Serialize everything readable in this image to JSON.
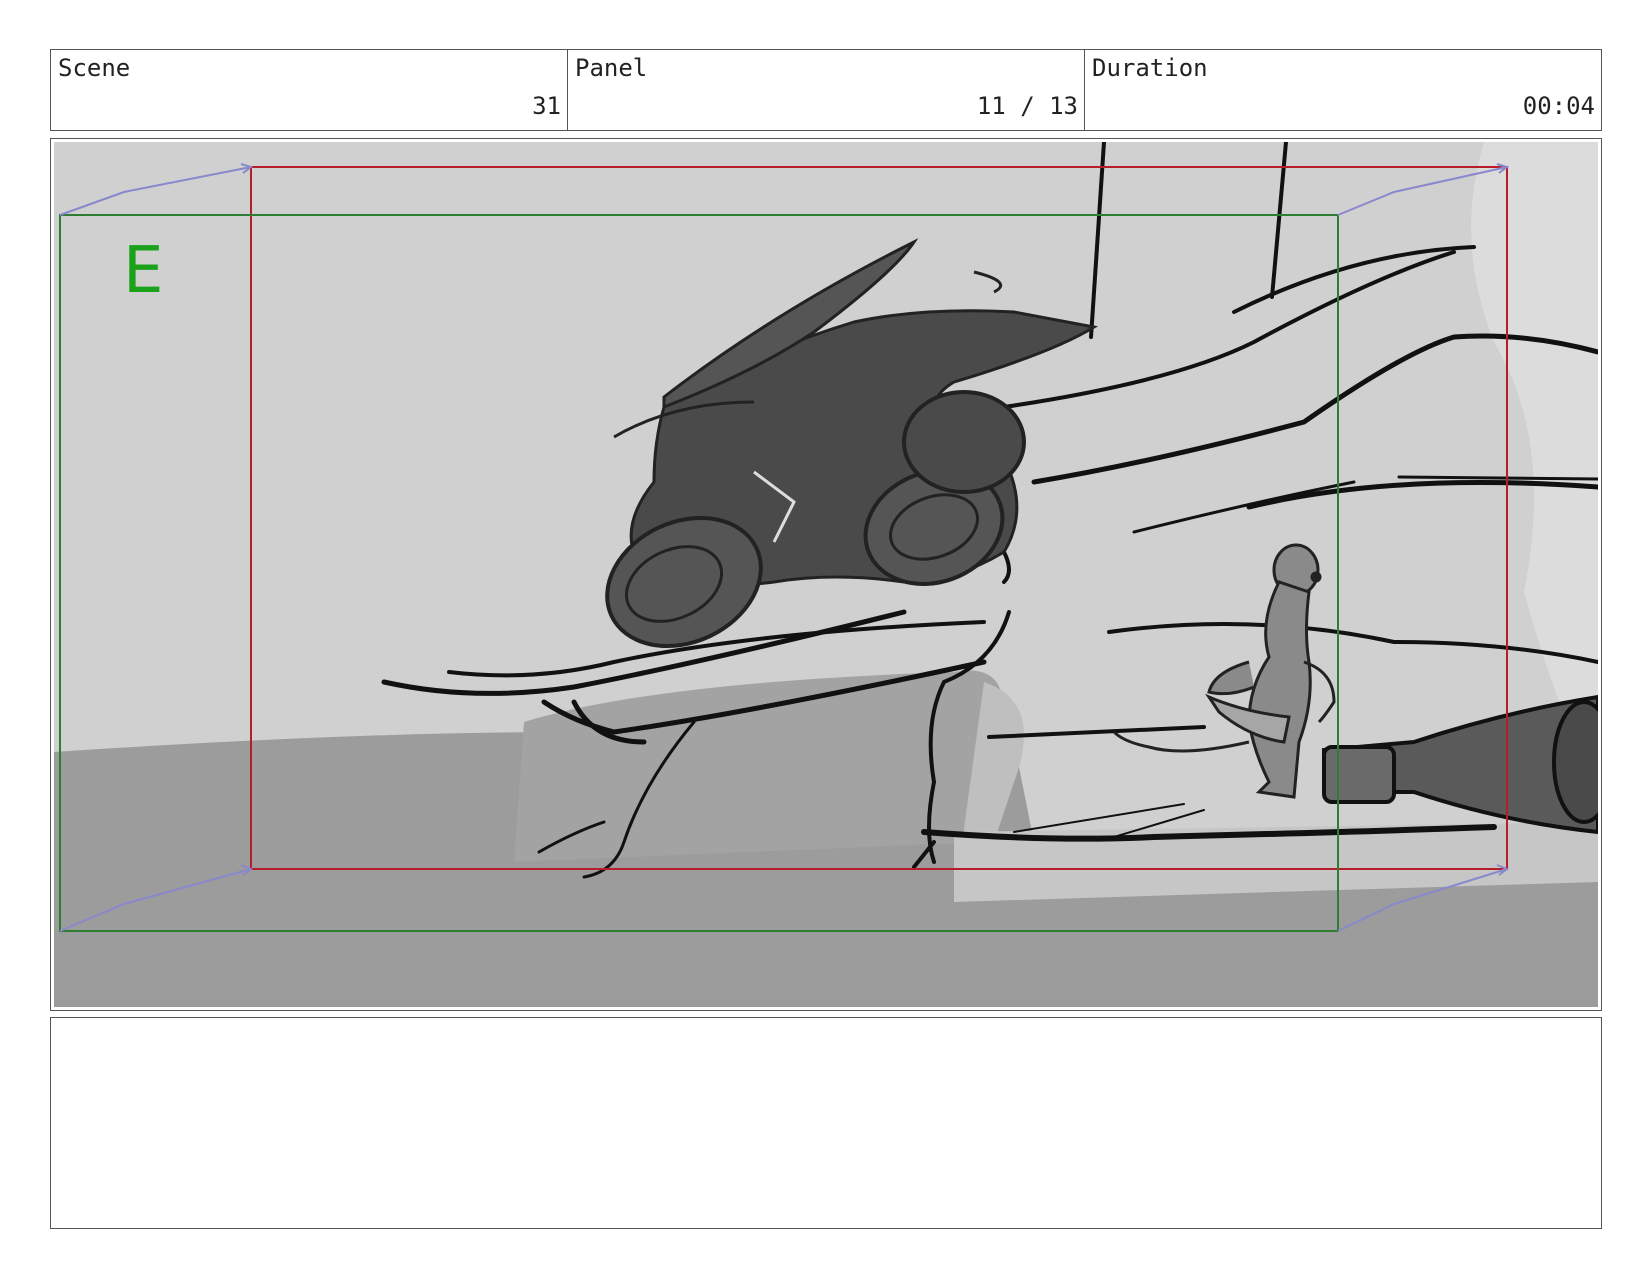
{
  "header": {
    "scene_label": "Scene",
    "scene_value": "31",
    "panel_label": "Panel",
    "panel_value": "11 / 13",
    "duration_label": "Duration",
    "duration_value": "00:04"
  },
  "frame": {
    "camera_mark": "E"
  },
  "notes": {
    "text": ""
  }
}
